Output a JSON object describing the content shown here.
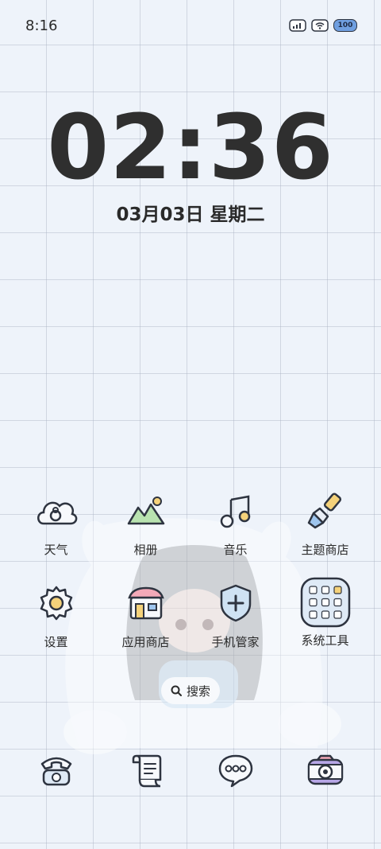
{
  "status_bar": {
    "time": "8:16",
    "battery": "100"
  },
  "lockscreen": {
    "clock": "02:36",
    "date": "03月03日 星期二"
  },
  "apps_row1": [
    {
      "label": "天气",
      "icon": "weather-cloud-icon"
    },
    {
      "label": "相册",
      "icon": "gallery-mountain-icon"
    },
    {
      "label": "音乐",
      "icon": "music-note-icon"
    },
    {
      "label": "主题商店",
      "icon": "theme-brush-icon"
    }
  ],
  "apps_row2": [
    {
      "label": "设置",
      "icon": "settings-gear-icon"
    },
    {
      "label": "应用商店",
      "icon": "app-store-shop-icon"
    },
    {
      "label": "手机管家",
      "icon": "phone-manager-shield-icon"
    },
    {
      "label": "系统工具",
      "icon": "system-tools-folder-icon"
    }
  ],
  "search": {
    "label": "搜索"
  },
  "dock": [
    {
      "icon": "phone-telephone-icon"
    },
    {
      "icon": "contacts-scroll-icon"
    },
    {
      "icon": "messages-bubble-icon"
    },
    {
      "icon": "camera-icon"
    }
  ],
  "colors": {
    "background": "#eef3fa",
    "outline": "#2e3440",
    "theme_blue": "#9ec5ee",
    "theme_yellow": "#f5d27a",
    "theme_pink": "#f4a9b8",
    "theme_green": "#b9e3b0",
    "theme_purple": "#b7a6e6"
  }
}
